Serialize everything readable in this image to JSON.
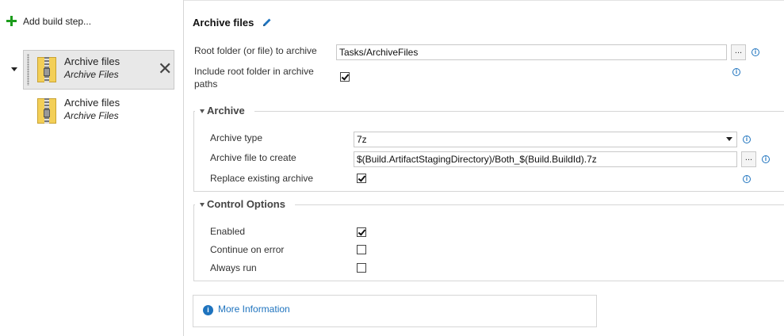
{
  "left_pane": {
    "add_step_label": "Add build step...",
    "steps": [
      {
        "title": "Archive files",
        "subtitle": "Archive Files",
        "selected": true
      },
      {
        "title": "Archive files",
        "subtitle": "Archive Files",
        "selected": false
      }
    ]
  },
  "editor": {
    "title": "Archive files",
    "root_folder": {
      "label": "Root folder (or file) to archive",
      "value": "Tasks/ArchiveFiles",
      "browse_label": "..."
    },
    "include_root": {
      "label_line1": "Include root folder in archive",
      "label_line2": "paths",
      "checked": true
    },
    "archive_group": {
      "title": "Archive",
      "archive_type": {
        "label": "Archive type",
        "value": "7z"
      },
      "archive_file": {
        "label": "Archive file to create",
        "value": "$(Build.ArtifactStagingDirectory)/Both_$(Build.BuildId).7z",
        "browse_label": "..."
      },
      "replace_existing": {
        "label": "Replace existing archive",
        "checked": true
      }
    },
    "control_group": {
      "title": "Control Options",
      "enabled": {
        "label": "Enabled",
        "checked": true
      },
      "continue_on_error": {
        "label": "Continue on error",
        "checked": false
      },
      "always_run": {
        "label": "Always run",
        "checked": false
      }
    },
    "more_info": {
      "label": "More Information",
      "icon_char": "i"
    },
    "info_icon_char": "i"
  },
  "colors": {
    "accent": "#1e73be",
    "add_icon": "#1c9c1c",
    "selected_bg": "#e8e8e8"
  }
}
